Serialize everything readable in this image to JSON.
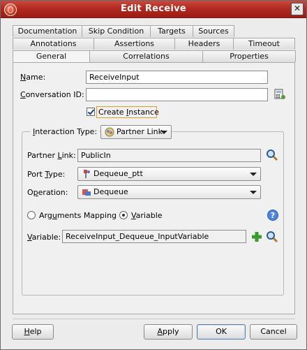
{
  "window": {
    "title": "Edit Receive"
  },
  "tabs": {
    "row1": [
      "Documentation",
      "Skip Condition",
      "Targets",
      "Sources"
    ],
    "row2": [
      "Annotations",
      "Assertions",
      "Headers",
      "Timeout"
    ],
    "row3": [
      "General",
      "Correlations",
      "Properties"
    ],
    "active": "General"
  },
  "form": {
    "name_label": "Name:",
    "name_value": "ReceiveInput",
    "conversation_label": "Conversation ID:",
    "conversation_value": "",
    "create_instance_label": "Create Instance",
    "create_instance_checked": true,
    "interaction_type_label": "Interaction Type:",
    "interaction_type_value": "Partner Link",
    "partner_link_label": "Partner Link:",
    "partner_link_value": "PublicIn",
    "port_type_label": "Port Type:",
    "port_type_value": "Dequeue_ptt",
    "operation_label": "Operation:",
    "operation_value": "Dequeue",
    "arguments_mapping_label": "Arguments Mapping",
    "variable_radio_label": "Variable",
    "selected_mode": "Variable",
    "variable_label": "Variable:",
    "variable_value": "ReceiveInput_Dequeue_InputVariable"
  },
  "buttons": {
    "help": "Help",
    "apply": "Apply",
    "ok": "OK",
    "cancel": "Cancel"
  },
  "icons": {
    "app": "oracle-app-icon",
    "close": "close-icon",
    "expression_builder": "expression-builder-icon",
    "search": "search-icon",
    "interaction": "partner-link-icon",
    "port": "port-type-icon",
    "operation": "operation-icon",
    "help": "help-icon",
    "add": "add-icon"
  }
}
